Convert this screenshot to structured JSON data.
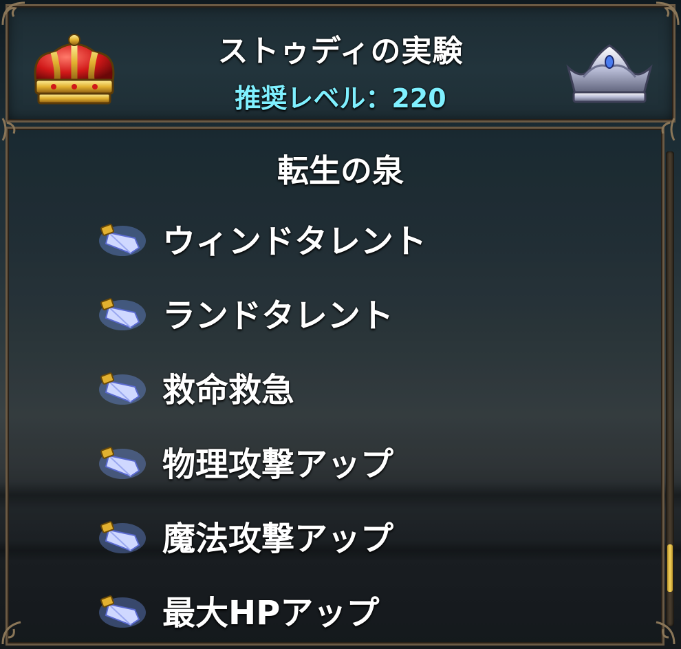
{
  "header": {
    "title": "ストゥディの実験",
    "recommended_level": "推奨レベル：220"
  },
  "panel": {
    "heading": "転生の泉",
    "skills": [
      {
        "label": "ウィンドタレント",
        "icon": "crystal-icon"
      },
      {
        "label": "ランドタレント",
        "icon": "crystal-icon"
      },
      {
        "label": "救命救急",
        "icon": "crystal-icon"
      },
      {
        "label": "物理攻撃アップ",
        "icon": "crystal-icon"
      },
      {
        "label": "魔法攻撃アップ",
        "icon": "crystal-icon"
      },
      {
        "label": "最大HPアップ",
        "icon": "crystal-icon"
      }
    ]
  },
  "scroll": {
    "position_fraction": 0.92,
    "visible_fraction": 0.1
  },
  "colors": {
    "title_text": "#ffffff",
    "level_text": "#7ff0ff",
    "frame": "#6b5a44",
    "scroll_thumb": "#f5d35c"
  },
  "icons": {
    "left_crown": "gold-crown-icon",
    "right_crown": "silver-crown-icon"
  }
}
